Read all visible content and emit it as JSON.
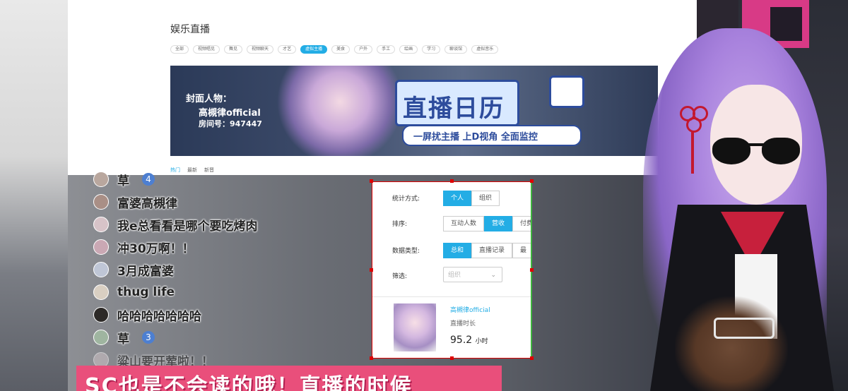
{
  "page": {
    "title": "娱乐直播",
    "tags": [
      {
        "label": "全部",
        "active": false
      },
      {
        "label": "视频唱见",
        "active": false
      },
      {
        "label": "舞见",
        "active": false
      },
      {
        "label": "视频聊天",
        "active": false
      },
      {
        "label": "才艺",
        "active": false
      },
      {
        "label": "虚拟主播",
        "active": true
      },
      {
        "label": "美食",
        "active": false
      },
      {
        "label": "户外",
        "active": false
      },
      {
        "label": "手工",
        "active": false
      },
      {
        "label": "绘画",
        "active": false
      },
      {
        "label": "学习",
        "active": false
      },
      {
        "label": "聊谈馆",
        "active": false
      },
      {
        "label": "虚拟音乐",
        "active": false
      }
    ],
    "banner": {
      "cover_label": "封面人物：",
      "cover_name": "高槻律official",
      "room_label": "房间号：947447",
      "logo_title": "直播日历",
      "logo_sub": "一屏扰主播  上D视角 全面监控"
    },
    "tabs": [
      "热门",
      "最新",
      "新晋"
    ]
  },
  "chat": {
    "messages": [
      {
        "text": "草",
        "count": "4"
      },
      {
        "text": "富婆高槻律"
      },
      {
        "text": "我e总看看是哪个要吃烤肉"
      },
      {
        "text": "冲30万啊！！"
      },
      {
        "text": "3月成富婆"
      },
      {
        "text": "thug life"
      },
      {
        "text": "哈哈哈哈哈哈哈"
      },
      {
        "text": "草",
        "count": "3"
      },
      {
        "text": "粱山要开荤啦！！"
      }
    ]
  },
  "stats_panel": {
    "stat_mode_label": "统计方式:",
    "stat_mode_options": [
      "个人",
      "组织"
    ],
    "sort_label": "排序:",
    "sort_options": [
      "互动人数",
      "营收",
      "付费"
    ],
    "data_type_label": "数据类型:",
    "data_type_options": [
      "总和",
      "直播记录",
      "最"
    ],
    "filter_label": "筛选:",
    "filter_placeholder": "组织",
    "streamer_name": "高槻律official",
    "metric_label": "直播时长",
    "metric_value": "95.2",
    "metric_unit": "小时"
  },
  "subtitle": {
    "text": "SC也是不会读的哦！直播的时候"
  },
  "colors": {
    "accent": "#23ade5",
    "subtitle_bg": "#e94f7b",
    "selection_border": "#dd0000"
  }
}
